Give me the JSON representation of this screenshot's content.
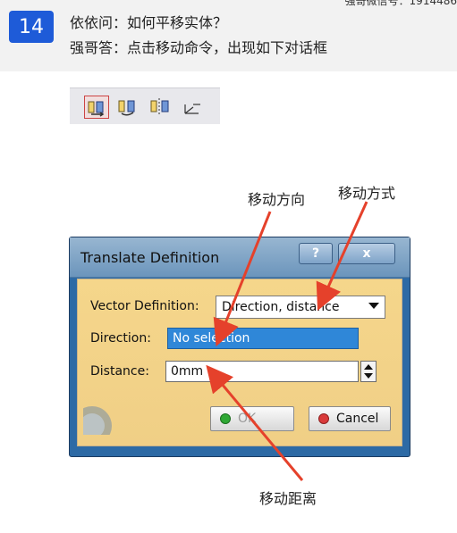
{
  "header": {
    "wechat_note": "强哥微信号：1914486",
    "badge": "14",
    "question": "依依问：如何平移实体？",
    "answer": "强哥答：点击移动命令，出现如下对话框"
  },
  "toolbar": {
    "icons": [
      "translate-icon",
      "rotate-icon",
      "symmetry-icon",
      "axis-to-axis-icon"
    ],
    "selected": "translate-icon"
  },
  "annotations": {
    "direction": "移动方向",
    "mode": "移动方式",
    "distance": "移动距离"
  },
  "dialog": {
    "title": "Translate Definition",
    "help_label": "?",
    "close_label": "x",
    "vector_definition_label": "Vector Definition:",
    "vector_definition_value": "Direction, distance",
    "direction_label": "Direction:",
    "direction_value": "No selection",
    "distance_label": "Distance:",
    "distance_value": "0mm",
    "ok_label": "OK",
    "cancel_label": "Cancel"
  },
  "colors": {
    "badge": "#1e5bd8",
    "dialog_body": "#f2d184",
    "title_bar": "#7ea3c8",
    "arrow": "#e5412b",
    "selection": "#2f87d8"
  }
}
